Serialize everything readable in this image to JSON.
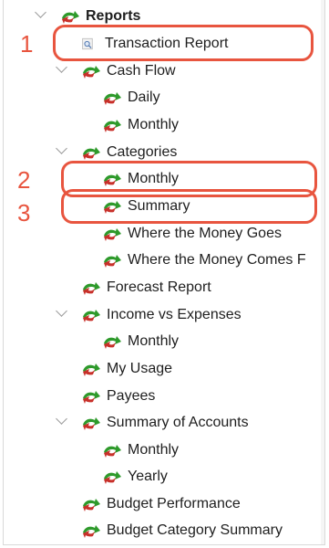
{
  "colors": {
    "callout": "#e8553f",
    "arrow_green": "#2e9a2b",
    "arrow_red": "#c8302a"
  },
  "tree": {
    "reports": "Reports",
    "transaction_report": "Transaction Report",
    "cash_flow": "Cash Flow",
    "cash_flow_daily": "Daily",
    "cash_flow_monthly": "Monthly",
    "categories": "Categories",
    "categories_monthly": "Monthly",
    "categories_summary": "Summary",
    "where_money_goes": "Where the Money Goes",
    "where_money_comes": "Where the Money Comes F",
    "forecast_report": "Forecast Report",
    "income_vs_expenses": "Income vs Expenses",
    "income_monthly": "Monthly",
    "my_usage": "My Usage",
    "payees": "Payees",
    "summary_of_accounts": "Summary of Accounts",
    "accounts_monthly": "Monthly",
    "accounts_yearly": "Yearly",
    "budget_performance": "Budget Performance",
    "budget_category_summary": "Budget Category Summary"
  },
  "annotations": {
    "one": "1",
    "two": "2",
    "three": "3"
  },
  "icons": {
    "report_group": "report-arrows-icon",
    "transaction_report": "magnifier-document-icon"
  }
}
